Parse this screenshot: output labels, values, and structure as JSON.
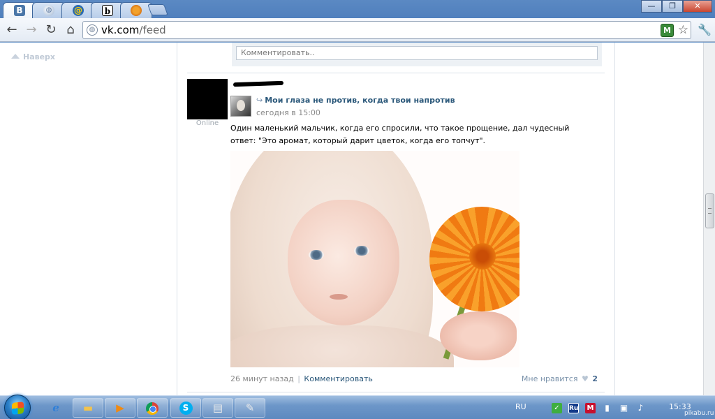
{
  "browser": {
    "tabs": [
      {
        "icon": "vk-favicon",
        "glyph": "B",
        "active": true
      },
      {
        "icon": "globe-favicon",
        "glyph": "◍",
        "active": false
      },
      {
        "icon": "mailru-favicon",
        "glyph": "@",
        "active": false
      },
      {
        "icon": "b-favicon",
        "glyph": "b",
        "active": false
      },
      {
        "icon": "pikabu-favicon",
        "glyph": "",
        "active": false
      }
    ],
    "url_host": "vk.com",
    "url_path": "/feed",
    "window_controls": {
      "minimize": "—",
      "restore": "❐",
      "close": "✕"
    }
  },
  "page": {
    "left_rail": {
      "to_top_label": "Наверх"
    },
    "comment_placeholder": "Комментировать..",
    "post": {
      "author_status": "Online",
      "repost_title": "Мои глаза не против, когда твои напротив",
      "repost_time": "сегодня в 15:00",
      "text": "Один маленький мальчик, когда его спросили, что такое прощение, дал чудесный ответ: \"Это аромат, который дарит цветок, когда его топчут\".",
      "footer_time": "26 минут назад",
      "footer_separator": "|",
      "comment_link": "Комментировать",
      "like_label": "Мне нравится",
      "like_count": "2"
    }
  },
  "taskbar": {
    "language": "RU",
    "tray_ru_label": "Ru",
    "clock": "15:33",
    "watermark": "pikabu.ru"
  },
  "colors": {
    "vk_link": "#2b587a",
    "taskbar": "#6d97c9",
    "browser_frame": "#5b89c3"
  }
}
